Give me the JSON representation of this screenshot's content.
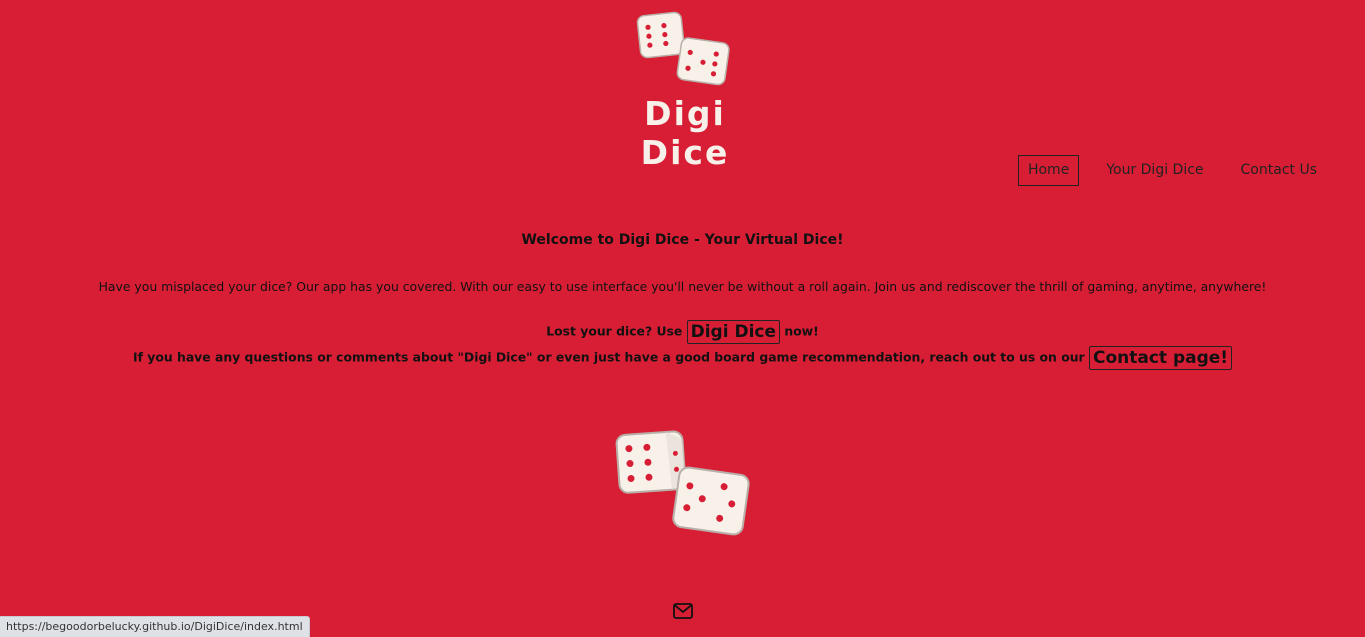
{
  "brand": {
    "name": "Digi Dice"
  },
  "nav": {
    "items": [
      {
        "label": "Home",
        "active": true
      },
      {
        "label": "Your Digi Dice",
        "active": false
      },
      {
        "label": "Contact Us",
        "active": false
      }
    ]
  },
  "main": {
    "welcome": "Welcome to Digi Dice - Your Virtual Dice!",
    "intro": "Have you misplaced your dice? Our app has you covered. With our easy to use interface you'll never be without a roll again. Join us and rediscover the thrill of gaming, anytime, anywhere!",
    "cta_prefix": "Lost your dice? Use",
    "cta_link": "Digi Dice",
    "cta_suffix": "now!",
    "contact_prefix": "If you have any questions or comments about \"Digi Dice\" or even just have a good board game recommendation, reach out to us on our",
    "contact_link": "Contact page!"
  },
  "footer": {
    "icon": "envelope-icon"
  },
  "status_bar": {
    "url": "https://begoodorbelucky.github.io/DigiDice/index.html"
  },
  "colors": {
    "background": "#d81e35",
    "dice": "#f7f1ea"
  }
}
